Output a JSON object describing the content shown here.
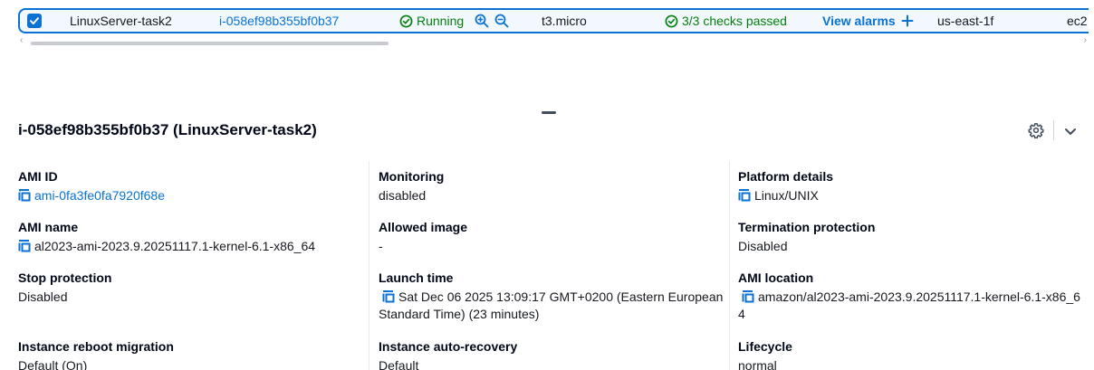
{
  "row": {
    "name": "LinuxServer-task2",
    "instance_id": "i-058ef98b355bf0b37",
    "state": "Running",
    "instance_type": "t3.micro",
    "status_checks": "3/3 checks passed",
    "alarms_link": "View alarms",
    "availability_zone": "us-east-1f",
    "public_dns": "ec2"
  },
  "details": {
    "title": "i-058ef98b355bf0b37 (LinuxServer-task2)",
    "fields": {
      "ami_id": {
        "label": "AMI ID",
        "value": "ami-0fa3fe0fa7920f68e"
      },
      "monitoring": {
        "label": "Monitoring",
        "value": "disabled"
      },
      "platform": {
        "label": "Platform details",
        "value": "Linux/UNIX"
      },
      "ami_name": {
        "label": "AMI name",
        "value": "al2023-ami-2023.9.20251117.1-kernel-6.1-x86_64"
      },
      "allowed_image": {
        "label": "Allowed image",
        "value": "-"
      },
      "termination": {
        "label": "Termination protection",
        "value": "Disabled"
      },
      "stop_protection": {
        "label": "Stop protection",
        "value": "Disabled"
      },
      "launch_time": {
        "label": "Launch time",
        "value": "Sat Dec 06 2025 13:09:17 GMT+0200 (Eastern European Standard Time) (23 minutes)"
      },
      "ami_location": {
        "label": "AMI location",
        "value": "amazon/al2023-ami-2023.9.20251117.1-kernel-6.1-x86_64"
      },
      "reboot_migration": {
        "label": "Instance reboot migration",
        "value": "Default (On)"
      },
      "auto_recovery": {
        "label": "Instance auto-recovery",
        "value": "Default"
      },
      "lifecycle": {
        "label": "Lifecycle",
        "value": "normal"
      }
    }
  },
  "icons": {
    "checkbox": "check-icon",
    "state": "check-circle-icon",
    "zoom_in": "zoom-in-icon",
    "zoom_out": "zoom-out-icon",
    "alarms_add": "plus-icon",
    "copy": "copy-icon",
    "settings": "gear-icon",
    "collapse": "chevron-down-icon"
  },
  "colors": {
    "link": "#0972d3",
    "success": "#037f0c",
    "selected_row_bg": "#f2f8fd",
    "text": "#16191f"
  }
}
